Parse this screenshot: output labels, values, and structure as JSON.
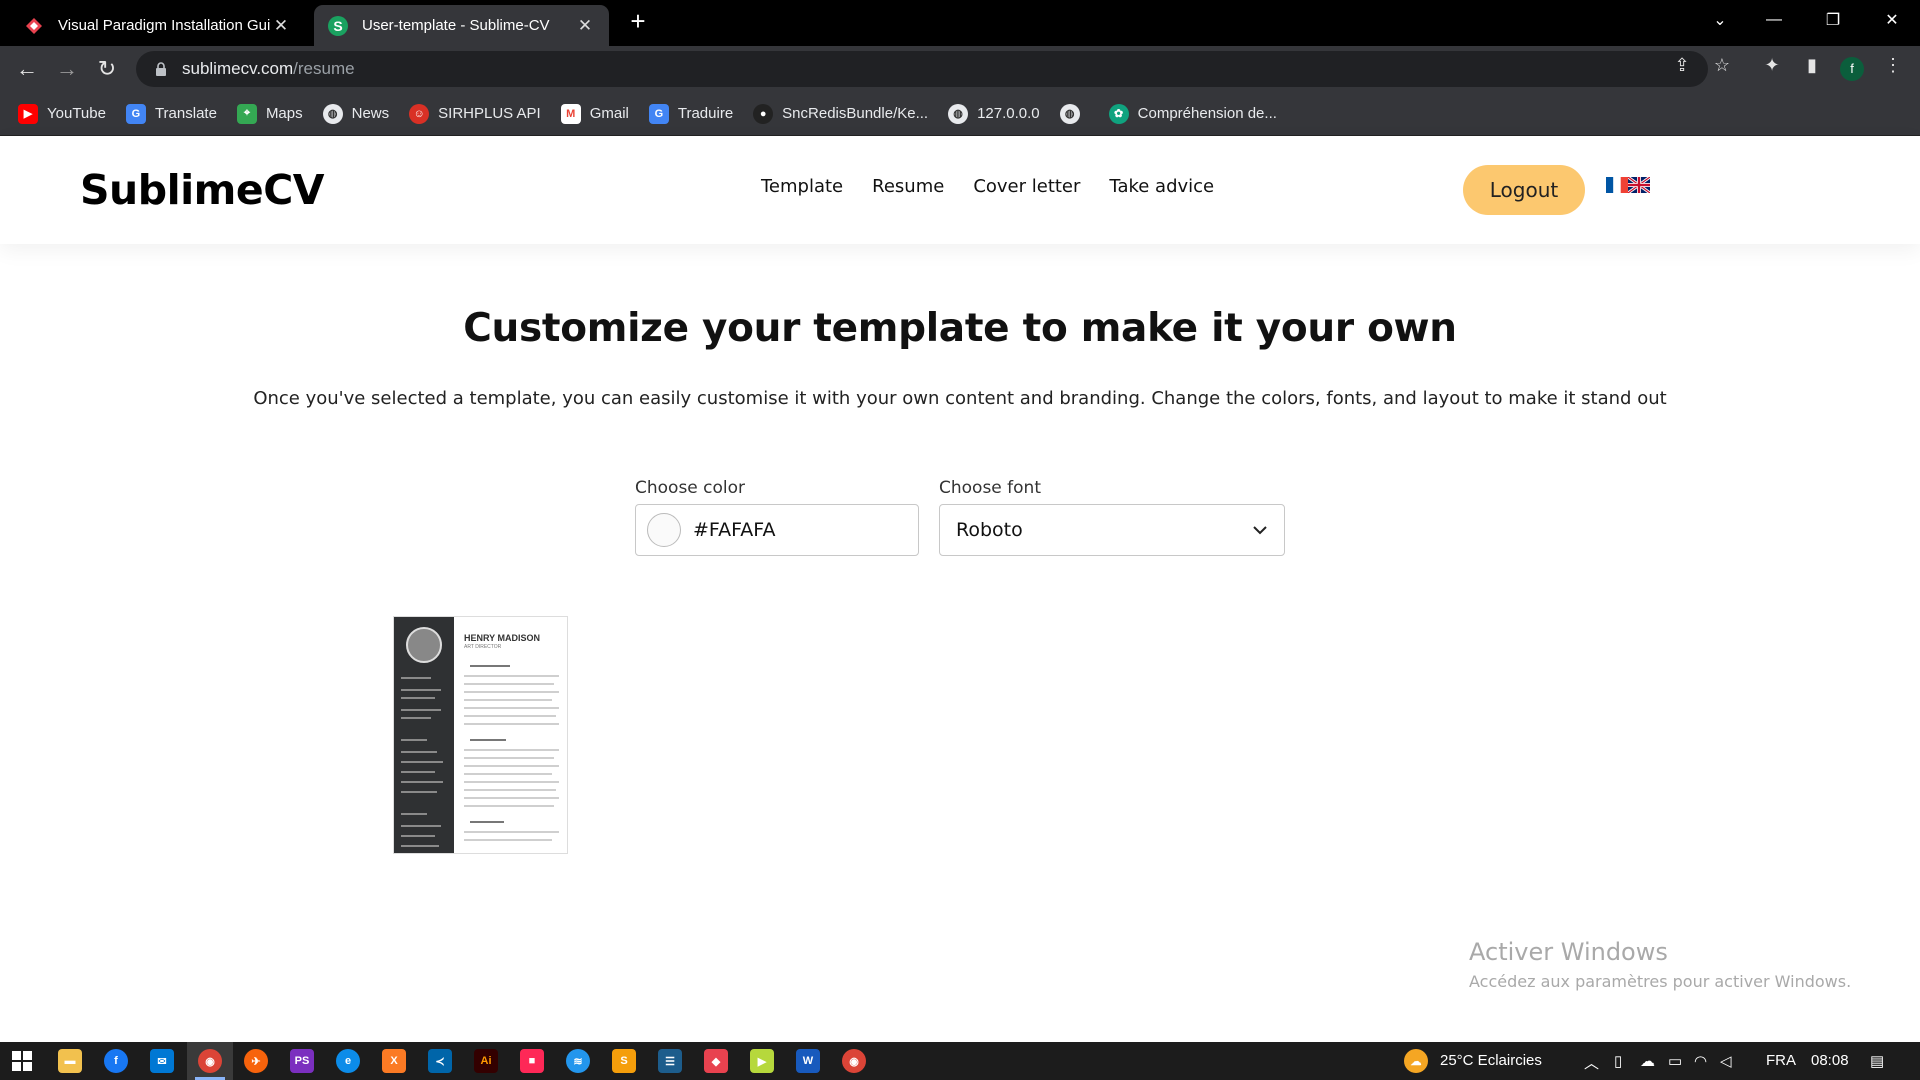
{
  "browser": {
    "tabs": [
      {
        "title": "Visual Paradigm Installation Gui",
        "favicon": "visual-paradigm-icon",
        "active": false
      },
      {
        "title": "User-template - Sublime-CV",
        "favicon": "sublimecv-icon",
        "active": true
      }
    ],
    "url_host": "sublimecv.com",
    "url_path": "/resume",
    "profile_initial": "f",
    "bookmarks": [
      {
        "label": "YouTube",
        "icon": "youtube-icon",
        "color": "#ff0000"
      },
      {
        "label": "Translate",
        "icon": "translate-icon",
        "color": "#4285f4"
      },
      {
        "label": "Maps",
        "icon": "maps-icon",
        "color": "#34a853"
      },
      {
        "label": "News",
        "icon": "globe-icon",
        "color": "#e8eaed"
      },
      {
        "label": "SIRHPLUS API",
        "icon": "sirhplus-icon",
        "color": "#d93025"
      },
      {
        "label": "Gmail",
        "icon": "gmail-icon",
        "color": "#ea4335"
      },
      {
        "label": "Traduire",
        "icon": "translate-icon",
        "color": "#4285f4"
      },
      {
        "label": "SncRedisBundle/Ke...",
        "icon": "github-icon",
        "color": "#222222"
      },
      {
        "label": "127.0.0.0",
        "icon": "globe-icon",
        "color": "#e8eaed"
      },
      {
        "label": "",
        "icon": "globe-icon",
        "color": "#e8eaed"
      },
      {
        "label": "Compréhension de...",
        "icon": "chatgpt-icon",
        "color": "#10a37f"
      }
    ]
  },
  "site": {
    "logo": "SublimeCV",
    "nav": [
      "Template",
      "Resume",
      "Cover letter",
      "Take advice"
    ],
    "logout_label": "Logout",
    "accent_color": "#fcc86f",
    "languages": [
      "fr",
      "en"
    ]
  },
  "main": {
    "title": "Customize your template to make it your own",
    "subtitle": "Once you've selected a template, you can easily customise it with your own content and branding. Change the colors, fonts, and layout to make it stand out",
    "color_label": "Choose color",
    "color_value": "#FAFAFA",
    "font_label": "Choose font",
    "font_value": "Roboto",
    "template_name": "HENRY MADISON",
    "template_role": "ART DIRECTOR"
  },
  "watermark": {
    "line1": "Activer Windows",
    "line2": "Accédez aux paramètres pour activer Windows."
  },
  "taskbar": {
    "weather": "25°C  Eclaircies",
    "language": "FRA",
    "time": "08:08"
  }
}
